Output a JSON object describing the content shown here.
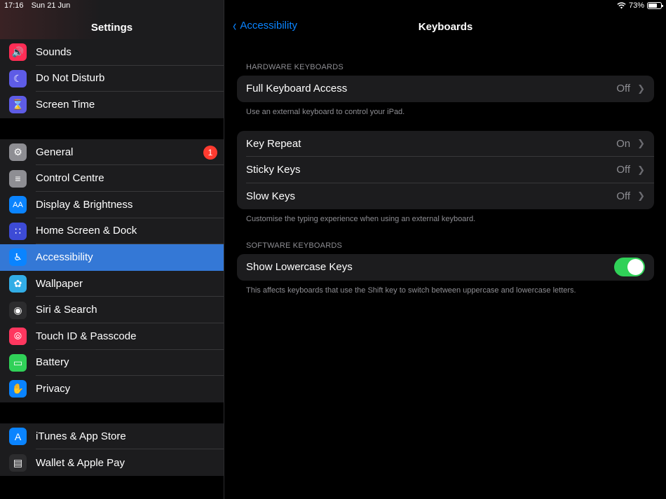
{
  "status": {
    "time": "17:16",
    "date": "Sun 21 Jun",
    "battery": "73%",
    "battery_level": 0.73
  },
  "sidebar": {
    "title": "Settings",
    "groups": [
      {
        "items": [
          {
            "label": "Sounds",
            "icon": "speaker-icon",
            "color": "#ff2d55"
          },
          {
            "label": "Do Not Disturb",
            "icon": "moon-icon",
            "color": "#5e5ce6"
          },
          {
            "label": "Screen Time",
            "icon": "hourglass-icon",
            "color": "#5e5ce6"
          }
        ]
      },
      {
        "items": [
          {
            "label": "General",
            "icon": "gear-icon",
            "color": "#8e8e93",
            "badge": "1"
          },
          {
            "label": "Control Centre",
            "icon": "toggles-icon",
            "color": "#8e8e93"
          },
          {
            "label": "Display & Brightness",
            "icon": "text-size-icon",
            "color": "#0a84ff"
          },
          {
            "label": "Home Screen & Dock",
            "icon": "grid-icon",
            "color": "#3d4bd6"
          },
          {
            "label": "Accessibility",
            "icon": "accessibility-icon",
            "color": "#0a84ff",
            "selected": true
          },
          {
            "label": "Wallpaper",
            "icon": "flower-icon",
            "color": "#32ade6"
          },
          {
            "label": "Siri & Search",
            "icon": "siri-icon",
            "color": "#2c2c2e"
          },
          {
            "label": "Touch ID & Passcode",
            "icon": "fingerprint-icon",
            "color": "#ff375f"
          },
          {
            "label": "Battery",
            "icon": "battery-icon",
            "color": "#30d158"
          },
          {
            "label": "Privacy",
            "icon": "hand-icon",
            "color": "#0a84ff"
          }
        ]
      },
      {
        "items": [
          {
            "label": "iTunes & App Store",
            "icon": "app-store-icon",
            "color": "#0a84ff"
          },
          {
            "label": "Wallet & Apple Pay",
            "icon": "wallet-icon",
            "color": "#2c2c2e"
          }
        ]
      }
    ]
  },
  "main": {
    "back_label": "Accessibility",
    "title": "Keyboards",
    "hardware_header": "HARDWARE KEYBOARDS",
    "full_keyboard_access": {
      "label": "Full Keyboard Access",
      "value": "Off"
    },
    "full_keyboard_footer": "Use an external keyboard to control your iPad.",
    "key_repeat": {
      "label": "Key Repeat",
      "value": "On"
    },
    "sticky_keys": {
      "label": "Sticky Keys",
      "value": "Off"
    },
    "slow_keys": {
      "label": "Slow Keys",
      "value": "Off"
    },
    "typing_footer": "Customise the typing experience when using an external keyboard.",
    "software_header": "SOFTWARE KEYBOARDS",
    "show_lowercase": {
      "label": "Show Lowercase Keys",
      "enabled": true
    },
    "lowercase_footer": "This affects keyboards that use the Shift key to switch between uppercase and lowercase letters."
  },
  "colors": {
    "accent": "#0a84ff",
    "selected_row": "#3478d6",
    "toggle_on": "#30d158",
    "badge": "#ff3b30"
  }
}
